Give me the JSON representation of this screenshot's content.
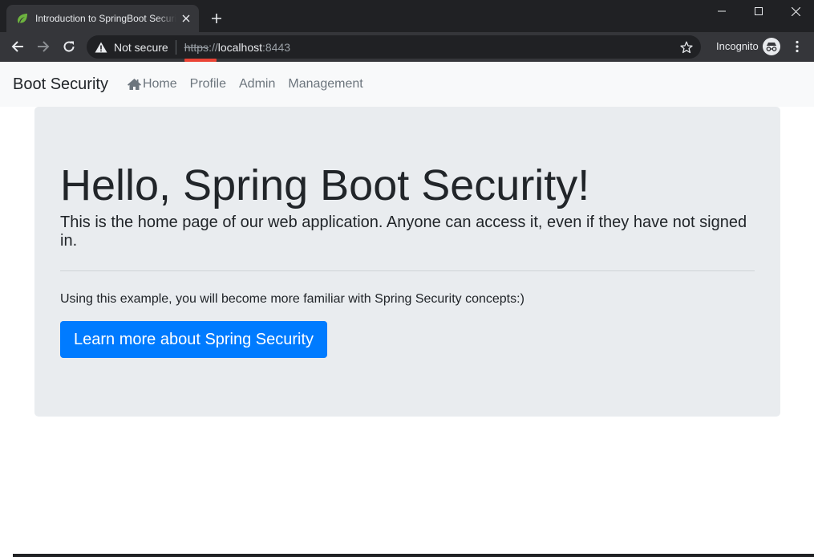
{
  "browser": {
    "tab": {
      "title": "Introduction to SpringBoot Security",
      "favicon": "spring-leaf-icon"
    },
    "security_label": "Not secure",
    "url": {
      "scheme": "https",
      "sep": "://",
      "host": "localhost",
      "port": ":8443"
    },
    "profile_label": "Incognito",
    "colors": {
      "titlebar": "#202124",
      "toolbar": "#35363a",
      "insecure_mark": "#ea4335"
    }
  },
  "navbar": {
    "brand": "Boot Security",
    "links": [
      {
        "label": "Home",
        "icon": "home-icon"
      },
      {
        "label": "Profile"
      },
      {
        "label": "Admin"
      },
      {
        "label": "Management"
      }
    ]
  },
  "jumbotron": {
    "heading": "Hello, Spring Boot Security!",
    "lead": "This is the home page of our web application. Anyone can access it, even if they have not signed in.",
    "body": "Using this example, you will become more familiar with Spring Security concepts:)",
    "button_label": "Learn more about Spring Security",
    "colors": {
      "background": "#e9ecef",
      "button": "#007bff"
    }
  }
}
